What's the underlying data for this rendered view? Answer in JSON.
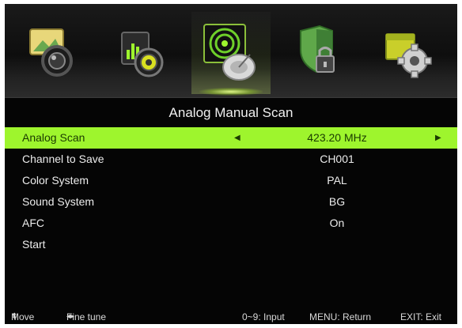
{
  "menu_tabs": [
    {
      "icon": "picture-camera-icon"
    },
    {
      "icon": "sound-speaker-icon"
    },
    {
      "icon": "channel-satellite-icon",
      "selected": true
    },
    {
      "icon": "lock-shield-icon"
    },
    {
      "icon": "setup-gear-icon"
    }
  ],
  "title": "Analog Manual Scan",
  "rows": [
    {
      "label": "Analog Scan",
      "value": "423.20 MHz",
      "selected": true
    },
    {
      "label": "Channel to Save",
      "value": "CH001"
    },
    {
      "label": "Color System",
      "value": "PAL"
    },
    {
      "label": "Sound System",
      "value": "BG"
    },
    {
      "label": "AFC",
      "value": "On"
    },
    {
      "label": "Start",
      "value": ""
    }
  ],
  "footer": {
    "move": "Move",
    "fine_tune": "Fine tune",
    "input": "0~9: Input",
    "menu": "MENU: Return",
    "exit": "EXIT: Exit"
  },
  "colors": {
    "highlight": "#9ef52d",
    "background": "#050505",
    "text": "#ececec"
  }
}
